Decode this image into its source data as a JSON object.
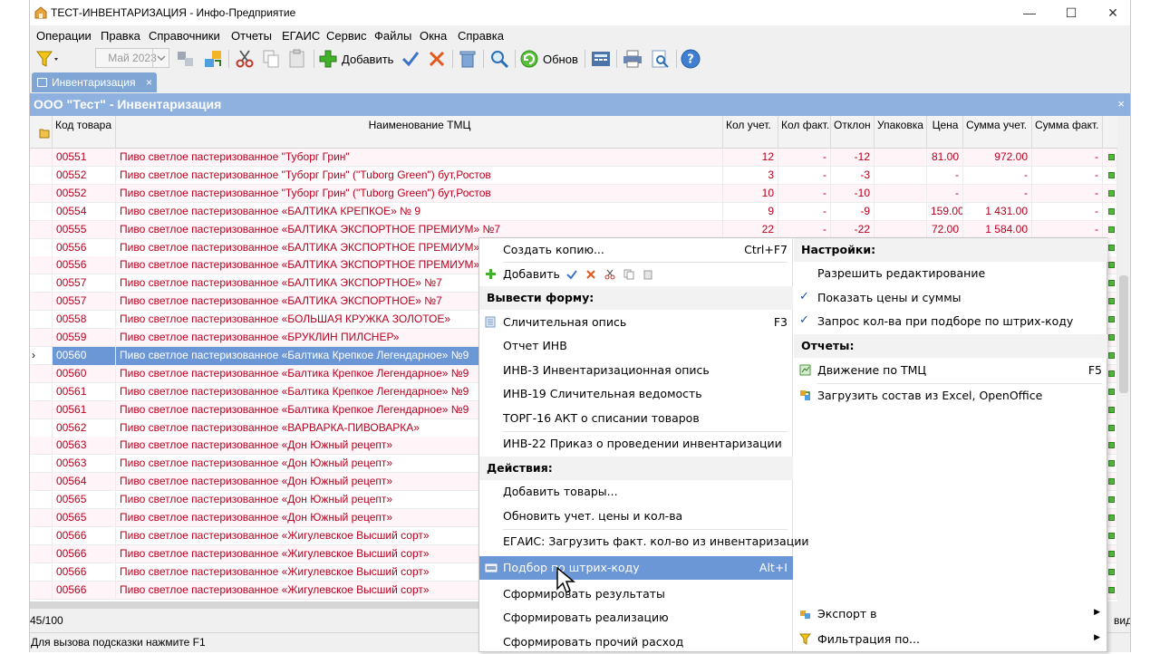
{
  "window": {
    "title": "ТЕСТ-ИНВЕНТАРИЗАЦИЯ - Инфо-Предприятие",
    "minimize": "—",
    "maximize": "☐",
    "close": "✕"
  },
  "menu": [
    "Операции",
    "Правка",
    "Справочники",
    "Отчеты",
    "ЕГАИС",
    "Сервис",
    "Файлы",
    "Окна",
    "Справка"
  ],
  "toolbar": {
    "period": "Май 2023",
    "add_label": "Добавить",
    "refresh_label": "Обнов"
  },
  "tab": {
    "label": "Инвентаризация",
    "close": "×"
  },
  "org_header": {
    "title": "ООО \"Тест\" -  Инвентаризация",
    "close": "×"
  },
  "grid": {
    "columns": [
      "Код товара",
      "Наименование ТМЦ",
      "Кол учет.",
      "Кол факт.",
      "Отклон",
      "Упаковка",
      "Цена",
      "Сумма учет.",
      "Сумма факт."
    ],
    "rows": [
      {
        "code": "00551",
        "name": "Пиво светлое пастеризованное \"Туборг Грин\"",
        "q1": "12",
        "q2": "-",
        "q3": "-12",
        "q4": "",
        "q5": "81.00",
        "q6": "972.00",
        "q7": "-"
      },
      {
        "code": "00552",
        "name": "Пиво светлое пастеризованное \"Туборг Грин\" (\"Tuborg Green\") бут,Ростов",
        "q1": "3",
        "q2": "-",
        "q3": "-3",
        "q4": "",
        "q5": "-",
        "q6": "-",
        "q7": "-"
      },
      {
        "code": "00552",
        "name": "Пиво светлое пастеризованное \"Туборг Грин\" (\"Tuborg Green\") бут,Ростов",
        "q1": "10",
        "q2": "-",
        "q3": "-10",
        "q4": "",
        "q5": "-",
        "q6": "-",
        "q7": "-"
      },
      {
        "code": "00554",
        "name": "Пиво светлое пастеризованное «БАЛТИКА КРЕПКОЕ» № 9",
        "q1": "9",
        "q2": "-",
        "q3": "-9",
        "q4": "",
        "q5": "159.00",
        "q6": "1 431.00",
        "q7": "-"
      },
      {
        "code": "00555",
        "name": "Пиво светлое пастеризованное «БАЛТИКА ЭКСПОРТНОЕ ПРЕМИУМ» №7",
        "q1": "22",
        "q2": "-",
        "q3": "-22",
        "q4": "",
        "q5": "72.00",
        "q6": "1 584.00",
        "q7": "-"
      },
      {
        "code": "00556",
        "name": "Пиво светлое пастеризованное «БАЛТИКА ЭКСПОРТНОЕ ПРЕМИУМ»",
        "q1": "",
        "q2": "",
        "q3": "",
        "q4": "",
        "q5": "",
        "q6": "",
        "q7": ""
      },
      {
        "code": "00556",
        "name": "Пиво светлое пастеризованное «БАЛТИКА ЭКСПОРТНОЕ ПРЕМИУМ»",
        "q1": "",
        "q2": "",
        "q3": "",
        "q4": "",
        "q5": "",
        "q6": "",
        "q7": ""
      },
      {
        "code": "00557",
        "name": "Пиво светлое пастеризованное «БАЛТИКА ЭКСПОРТНОЕ» №7",
        "q1": "",
        "q2": "",
        "q3": "",
        "q4": "",
        "q5": "",
        "q6": "",
        "q7": ""
      },
      {
        "code": "00557",
        "name": "Пиво светлое пастеризованное «БАЛТИКА ЭКСПОРТНОЕ» №7",
        "q1": "",
        "q2": "",
        "q3": "",
        "q4": "",
        "q5": "",
        "q6": "",
        "q7": ""
      },
      {
        "code": "00558",
        "name": "Пиво светлое пастеризованное «БОЛЬШАЯ КРУЖКА ЗОЛОТОЕ»",
        "q1": "",
        "q2": "",
        "q3": "",
        "q4": "",
        "q5": "",
        "q6": "",
        "q7": ""
      },
      {
        "code": "00559",
        "name": "Пиво светлое пастеризованное «БРУКЛИН ПИЛСНЕР»",
        "q1": "",
        "q2": "",
        "q3": "",
        "q4": "",
        "q5": "",
        "q6": "",
        "q7": ""
      },
      {
        "code": "00560",
        "name": "Пиво светлое пастеризованное «Балтика Крепкое Легендарное» №9",
        "q1": "",
        "q2": "",
        "q3": "",
        "q4": "",
        "q5": "",
        "q6": "",
        "q7": "",
        "selected": true
      },
      {
        "code": "00560",
        "name": "Пиво светлое пастеризованное «Балтика Крепкое Легендарное» №9",
        "q1": "",
        "q2": "",
        "q3": "",
        "q4": "",
        "q5": "",
        "q6": "",
        "q7": ""
      },
      {
        "code": "00561",
        "name": "Пиво светлое пастеризованное «Балтика Крепкое Легендарное» №9",
        "q1": "",
        "q2": "",
        "q3": "",
        "q4": "",
        "q5": "",
        "q6": "",
        "q7": ""
      },
      {
        "code": "00561",
        "name": "Пиво светлое пастеризованное «Балтика Крепкое Легендарное» №9",
        "q1": "",
        "q2": "",
        "q3": "",
        "q4": "",
        "q5": "",
        "q6": "",
        "q7": ""
      },
      {
        "code": "00562",
        "name": "Пиво светлое пастеризованное «ВАРВАРКА-ПИВОВАРКА»",
        "q1": "",
        "q2": "",
        "q3": "",
        "q4": "",
        "q5": "",
        "q6": "",
        "q7": ""
      },
      {
        "code": "00563",
        "name": "Пиво светлое пастеризованное «Дон Южный рецепт»",
        "q1": "",
        "q2": "",
        "q3": "",
        "q4": "",
        "q5": "",
        "q6": "",
        "q7": ""
      },
      {
        "code": "00563",
        "name": "Пиво светлое пастеризованное «Дон Южный рецепт»",
        "q1": "",
        "q2": "",
        "q3": "",
        "q4": "",
        "q5": "",
        "q6": "",
        "q7": ""
      },
      {
        "code": "00564",
        "name": "Пиво светлое пастеризованное «Дон Южный рецепт»",
        "q1": "",
        "q2": "",
        "q3": "",
        "q4": "",
        "q5": "",
        "q6": "",
        "q7": ""
      },
      {
        "code": "00565",
        "name": "Пиво светлое пастеризованное «Дон Южный рецепт»",
        "q1": "",
        "q2": "",
        "q3": "",
        "q4": "",
        "q5": "",
        "q6": "",
        "q7": ""
      },
      {
        "code": "00565",
        "name": "Пиво светлое пастеризованное «Дон Южный рецепт»",
        "q1": "",
        "q2": "",
        "q3": "",
        "q4": "",
        "q5": "",
        "q6": "",
        "q7": ""
      },
      {
        "code": "00566",
        "name": "Пиво светлое пастеризованное «Жигулевское Высший сорт»",
        "q1": "",
        "q2": "",
        "q3": "",
        "q4": "",
        "q5": "",
        "q6": "",
        "q7": ""
      },
      {
        "code": "00566",
        "name": "Пиво светлое пастеризованное «Жигулевское Высший сорт»",
        "q1": "",
        "q2": "",
        "q3": "",
        "q4": "",
        "q5": "",
        "q6": "",
        "q7": ""
      },
      {
        "code": "00566",
        "name": "Пиво светлое пастеризованное «Жигулевское Высший сорт»",
        "q1": "",
        "q2": "",
        "q3": "",
        "q4": "",
        "q5": "",
        "q6": "",
        "q7": ""
      },
      {
        "code": "00566",
        "name": "Пиво светлое пастеризованное «Жигулевское Высший сорт»",
        "q1": "",
        "q2": "",
        "q3": "",
        "q4": "",
        "q5": "",
        "q6": "",
        "q7": ""
      }
    ]
  },
  "footer": {
    "counter": "45/100",
    "right_text": "вид"
  },
  "status": {
    "hint": "Для вызова подсказки нажмите F1"
  },
  "context_menu": {
    "left": {
      "create_copy": "Создать копию...",
      "create_copy_sc": "Ctrl+F7",
      "add": "Добавить",
      "form_header": "Вывести форму:",
      "sverka": "Сличительная опись",
      "sverka_sc": "F3",
      "inv_report": "Отчет ИНВ",
      "inv3": "ИНВ-3 Инвентаризационная опись",
      "inv19": "ИНВ-19 Сличительная ведомость",
      "torg16": "ТОРГ-16 АКТ о списании товаров",
      "inv22": "ИНВ-22 Приказ о проведении инвентаризации",
      "actions_header": "Действия:",
      "add_goods": "Добавить товары...",
      "update_prices": "Обновить учет. цены и кол-ва",
      "egais_load": "ЕГАИС: Загрузить факт. кол-во из инвентаризации",
      "barcode": "Подбор по штрих-коду",
      "barcode_sc": "Alt+I",
      "form_results": "Сформировать результаты",
      "form_sale": "Сформировать реализацию",
      "form_other": "Сформировать прочий расход"
    },
    "right": {
      "settings_header": "Настройки:",
      "allow_edit": "Разрешить редактирование",
      "show_prices": "Показать цены и суммы",
      "ask_qty": "Запрос кол-ва при подборе по штрих-коду",
      "check": "✓",
      "reports_header": "Отчеты:",
      "movement": "Движение по ТМЦ",
      "movement_sc": "F5",
      "load_excel": "Загрузить состав из Excel, OpenOffice",
      "export": "Экспорт в",
      "filter": "Фильтрация по..."
    }
  }
}
